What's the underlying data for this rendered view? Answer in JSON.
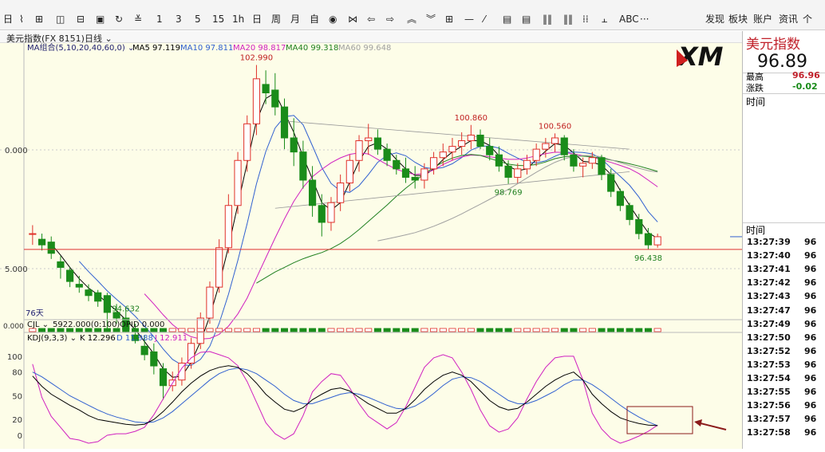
{
  "toolbar": {
    "tools_left": [
      "日",
      "分时",
      "图表",
      "周期",
      "1",
      "3",
      "5",
      "15",
      "1h",
      "日",
      "周",
      "月",
      "自"
    ],
    "menu": [
      "发现",
      "板块",
      "账户",
      "资讯",
      "个"
    ],
    "abc": "ABC",
    "more": "···"
  },
  "titlebar": {
    "instrument": "美元指数(FX 8151)",
    "period": "日线"
  },
  "ma_legend": {
    "group": "MA组合(5,10,20,40,60,0)",
    "ma5": "MA5 97.119",
    "ma10": "MA10 97.811",
    "ma20": "MA20 98.817",
    "ma40": "MA40 99.318",
    "ma60": "MA60 99.648"
  },
  "colors": {
    "up": "#e0302a",
    "down": "#1a8c1a",
    "ma5": "#000000",
    "ma10": "#3060d0",
    "ma20": "#d020c0",
    "ma40": "#208020",
    "ma60": "#a0a0a0",
    "k": "#000000",
    "d": "#3060d0",
    "j": "#d020c0"
  },
  "annotations": [
    "102.990",
    "100.860",
    "100.560",
    "98.769",
    "94.632",
    "96.438"
  ],
  "y_ticks": [
    "0.000",
    "5.000"
  ],
  "days_label": "76天",
  "vol_legend": {
    "name": "CJL",
    "vol": "5922.000(0:100)",
    "opid": "OPID 0.000"
  },
  "vol_tick": "0.000",
  "kdj_legend": {
    "name": "KDJ(9,3,3)",
    "k": "K 12.296",
    "d": "D 11.988",
    "j": "J 12.911"
  },
  "kdj_ticks": [
    "100",
    "80",
    "50",
    "20",
    "0"
  ],
  "logo": "XM",
  "right_panel": {
    "title": "美元指数",
    "price": "96.89",
    "high_label": "最高",
    "high_value": "96.96",
    "change_label": "涨跌",
    "change_value": "-0.02",
    "time_label": "时间",
    "tick_header": "时间",
    "ticks": [
      "13:27:39",
      "13:27:40",
      "13:27:41",
      "13:27:42",
      "13:27:43",
      "13:27:47",
      "13:27:49",
      "13:27:50",
      "13:27:52",
      "13:27:53",
      "13:27:54",
      "13:27:55",
      "13:27:56",
      "13:27:57",
      "13:27:58"
    ],
    "tick_vals": [
      "96",
      "96",
      "96",
      "96",
      "96",
      "96",
      "96",
      "96",
      "96",
      "96",
      "96",
      "96",
      "96",
      "96",
      "96"
    ]
  },
  "chart_data": {
    "type": "candlestick",
    "ylim": [
      94.0,
      103.6
    ],
    "candles": [
      [
        97.0,
        97.3,
        96.6,
        97.0
      ],
      [
        96.8,
        97.0,
        96.4,
        96.6
      ],
      [
        96.7,
        96.9,
        96.1,
        96.3
      ],
      [
        96.0,
        96.2,
        95.4,
        95.8
      ],
      [
        95.7,
        95.8,
        95.1,
        95.3
      ],
      [
        95.2,
        95.5,
        94.9,
        95.1
      ],
      [
        95.0,
        95.2,
        94.6,
        94.8
      ],
      [
        94.9,
        95.0,
        94.4,
        94.6
      ],
      [
        94.8,
        94.9,
        93.6,
        94.2
      ],
      [
        94.2,
        94.5,
        93.8,
        94.0
      ],
      [
        94.0,
        94.3,
        93.5,
        93.6
      ],
      [
        93.4,
        93.8,
        93.1,
        93.2
      ],
      [
        93.0,
        93.4,
        92.5,
        92.7
      ],
      [
        92.8,
        93.1,
        92.0,
        92.3
      ],
      [
        92.2,
        92.4,
        91.1,
        91.6
      ],
      [
        91.6,
        92.1,
        91.4,
        91.8
      ],
      [
        91.8,
        92.6,
        91.6,
        92.4
      ],
      [
        92.4,
        93.3,
        92.2,
        93.1
      ],
      [
        93.1,
        94.2,
        92.9,
        94.0
      ],
      [
        94.0,
        95.3,
        93.8,
        95.1
      ],
      [
        95.1,
        96.8,
        94.9,
        96.5
      ],
      [
        96.5,
        98.4,
        96.3,
        98.0
      ],
      [
        98.0,
        99.9,
        97.7,
        99.6
      ],
      [
        99.6,
        101.2,
        99.2,
        100.9
      ],
      [
        100.9,
        102.99,
        100.5,
        102.5
      ],
      [
        102.3,
        102.8,
        101.6,
        102.0
      ],
      [
        102.1,
        102.7,
        101.2,
        101.5
      ],
      [
        101.5,
        101.8,
        100.0,
        100.4
      ],
      [
        100.4,
        101.1,
        99.4,
        99.9
      ],
      [
        99.9,
        100.3,
        98.6,
        98.9
      ],
      [
        98.9,
        99.4,
        97.6,
        98.0
      ],
      [
        98.0,
        98.4,
        96.9,
        97.4
      ],
      [
        97.4,
        98.3,
        97.1,
        98.1
      ],
      [
        98.1,
        99.1,
        97.8,
        98.8
      ],
      [
        98.8,
        99.8,
        98.5,
        99.6
      ],
      [
        99.6,
        100.5,
        99.2,
        100.3
      ],
      [
        100.3,
        100.9,
        99.8,
        100.4
      ],
      [
        100.4,
        100.7,
        99.8,
        100.0
      ],
      [
        100.0,
        100.2,
        99.4,
        99.6
      ],
      [
        99.6,
        99.8,
        99.1,
        99.3
      ],
      [
        99.3,
        99.7,
        98.8,
        99.0
      ],
      [
        99.0,
        99.4,
        98.6,
        98.9
      ],
      [
        98.9,
        99.5,
        98.6,
        99.3
      ],
      [
        99.3,
        99.9,
        99.1,
        99.7
      ],
      [
        99.7,
        100.2,
        99.4,
        99.9
      ],
      [
        99.9,
        100.4,
        99.6,
        100.1
      ],
      [
        100.1,
        100.6,
        99.8,
        100.3
      ],
      [
        100.3,
        100.86,
        100.0,
        100.5
      ],
      [
        100.5,
        100.7,
        100.0,
        100.1
      ],
      [
        100.1,
        100.4,
        99.6,
        99.8
      ],
      [
        99.8,
        100.1,
        99.2,
        99.4
      ],
      [
        99.4,
        99.6,
        98.77,
        99.0
      ],
      [
        99.0,
        99.5,
        98.8,
        99.3
      ],
      [
        99.3,
        99.8,
        99.1,
        99.6
      ],
      [
        99.6,
        100.2,
        99.4,
        100.0
      ],
      [
        100.0,
        100.4,
        99.7,
        100.2
      ],
      [
        100.2,
        100.56,
        99.9,
        100.4
      ],
      [
        100.4,
        100.5,
        99.6,
        99.8
      ],
      [
        99.8,
        100.0,
        99.2,
        99.4
      ],
      [
        99.4,
        99.7,
        99.0,
        99.5
      ],
      [
        99.5,
        99.9,
        99.3,
        99.7
      ],
      [
        99.7,
        99.8,
        98.9,
        99.1
      ],
      [
        99.1,
        99.3,
        98.3,
        98.5
      ],
      [
        98.5,
        98.6,
        97.8,
        98.0
      ],
      [
        98.0,
        98.1,
        97.3,
        97.5
      ],
      [
        97.5,
        97.7,
        96.8,
        97.0
      ],
      [
        97.0,
        97.2,
        96.438,
        96.6
      ],
      [
        96.6,
        97.0,
        96.5,
        96.89
      ]
    ],
    "volume": [
      5922,
      5922,
      5922,
      5922,
      5922,
      5922,
      5922,
      5922,
      5922,
      5922,
      5922,
      5922,
      5922,
      5922,
      5922,
      5922,
      5922,
      5922,
      5922,
      5922,
      5922,
      5922,
      5922,
      5922,
      5922,
      5922,
      5922,
      5922,
      5922,
      5922,
      5922,
      5922,
      5922,
      5922,
      5922,
      5922,
      5922,
      5922,
      5922,
      5922,
      5922,
      5922,
      5922,
      5922,
      5922,
      5922,
      5922,
      5922,
      5922,
      5922,
      5922,
      5922,
      5922,
      5922,
      5922,
      5922,
      5922,
      5922,
      5922,
      5922,
      5922,
      5922,
      5922,
      5922,
      5922,
      5922,
      5922,
      5922
    ],
    "kdj": {
      "k": [
        75,
        62,
        52,
        45,
        38,
        32,
        25,
        20,
        18,
        16,
        14,
        13,
        14,
        20,
        30,
        42,
        55,
        66,
        75,
        82,
        86,
        88,
        86,
        78,
        66,
        52,
        42,
        33,
        30,
        35,
        45,
        52,
        58,
        60,
        56,
        48,
        40,
        34,
        28,
        28,
        34,
        45,
        58,
        68,
        76,
        80,
        76,
        68,
        56,
        44,
        36,
        32,
        34,
        42,
        52,
        62,
        70,
        76,
        80,
        70,
        52,
        40,
        30,
        22,
        18,
        15,
        13,
        12.3
      ],
      "d": [
        80,
        74,
        66,
        58,
        50,
        44,
        38,
        32,
        27,
        23,
        20,
        17,
        16,
        17,
        22,
        30,
        40,
        50,
        60,
        70,
        78,
        83,
        85,
        83,
        78,
        70,
        62,
        52,
        44,
        40,
        40,
        44,
        48,
        52,
        54,
        52,
        48,
        43,
        38,
        34,
        33,
        37,
        44,
        53,
        63,
        71,
        74,
        73,
        68,
        60,
        52,
        44,
        40,
        40,
        44,
        50,
        56,
        64,
        70,
        70,
        64,
        56,
        47,
        38,
        30,
        23,
        17,
        12.0
      ],
      "j": [
        90,
        48,
        24,
        10,
        -4,
        -6,
        -10,
        -8,
        0,
        2,
        2,
        5,
        10,
        26,
        46,
        66,
        85,
        98,
        105,
        106,
        102,
        98,
        88,
        68,
        42,
        16,
        2,
        -5,
        2,
        25,
        55,
        68,
        78,
        76,
        60,
        40,
        24,
        16,
        8,
        16,
        36,
        61,
        86,
        98,
        102,
        98,
        80,
        58,
        32,
        12,
        4,
        8,
        22,
        46,
        68,
        86,
        98,
        100,
        100,
        70,
        28,
        8,
        -4,
        -10,
        -6,
        -1,
        5,
        12.9
      ]
    },
    "kdj_ylim": [
      -5,
      110
    ],
    "series": [
      {
        "name": "MA5"
      },
      {
        "name": "MA10"
      },
      {
        "name": "MA20"
      },
      {
        "name": "MA40"
      },
      {
        "name": "MA60"
      }
    ]
  }
}
